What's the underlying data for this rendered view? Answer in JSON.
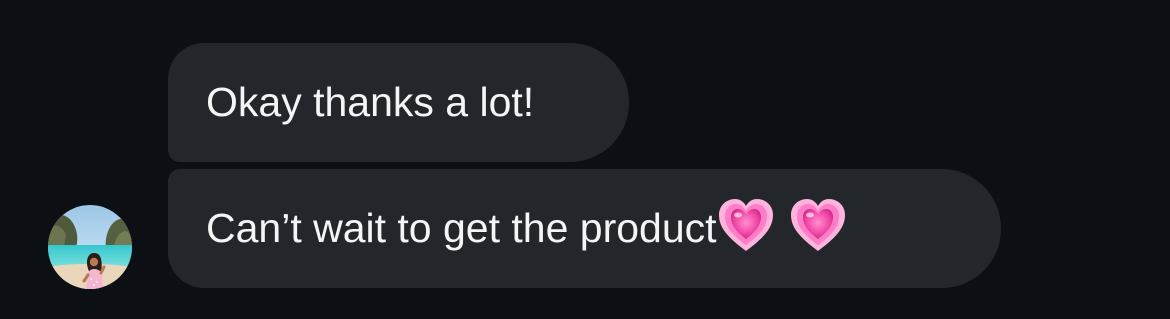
{
  "messages": [
    {
      "text": "Okay thanks a lot!",
      "emojis": []
    },
    {
      "text": "Can’t wait to get the product",
      "emojis": [
        "growing-heart-emoji",
        "growing-heart-emoji"
      ]
    }
  ],
  "sender": {
    "avatar_icon": "avatar-photo"
  },
  "colors": {
    "background": "#0c1014",
    "bubble": "#23272b",
    "text": "#f3f5f7",
    "heart": "#ff4fb3"
  }
}
